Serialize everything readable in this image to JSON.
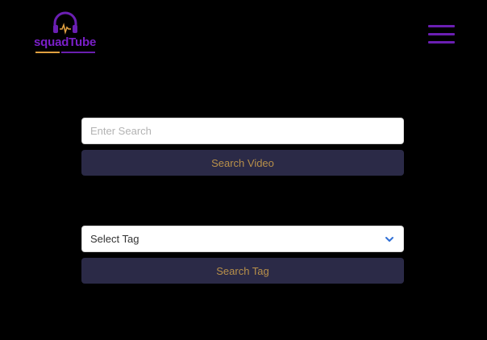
{
  "header": {
    "logo_text": "squadTube",
    "menu_icon": "hamburger-menu-icon",
    "colors": {
      "brand": "#6b1fb3",
      "accent": "#e0a040"
    }
  },
  "search": {
    "placeholder": "Enter Search",
    "value": "",
    "button_label": "Search Video"
  },
  "tags": {
    "selected": "Select Tag",
    "button_label": "Search Tag",
    "chevron_icon": "chevron-down-icon"
  },
  "colors": {
    "background": "#000000",
    "button_bg": "#2b2a47",
    "button_text": "#b8904a",
    "chevron": "#2f6fd6"
  }
}
